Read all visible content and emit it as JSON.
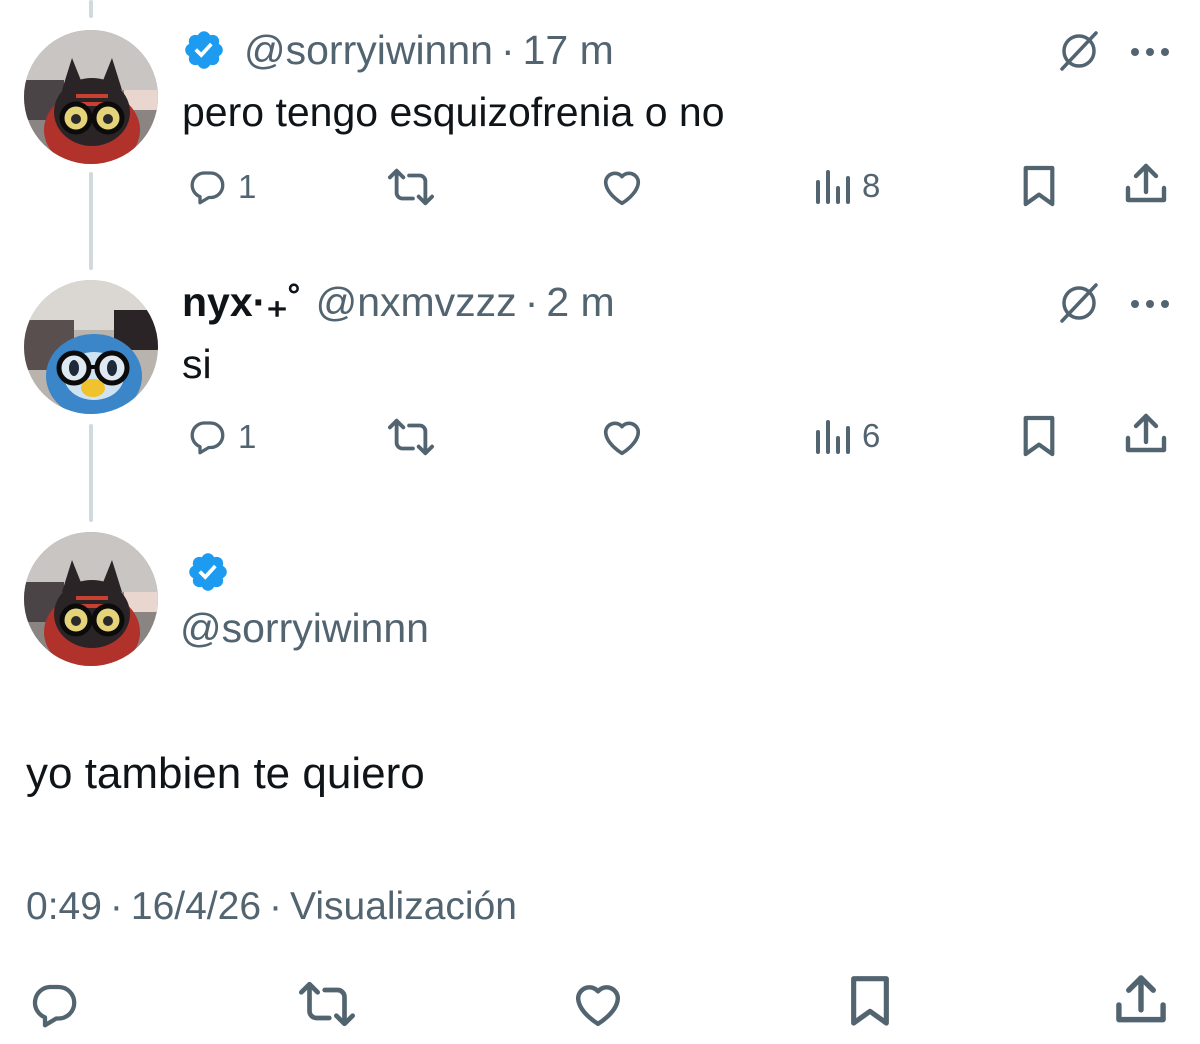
{
  "tweets": [
    {
      "handle": "@sorryiwinnn",
      "time": "17 m",
      "text": "pero tengo esquizofrenia o no",
      "replies": "1",
      "views": "8",
      "avatar_icon": "litten-plush-avatar"
    },
    {
      "name": "nyx·₊˚",
      "handle": "@nxmvzzz",
      "time": "2 m",
      "text": "si",
      "replies": "1",
      "views": "6",
      "avatar_icon": "piplup-plush-avatar"
    }
  ],
  "main_tweet": {
    "handle": "@sorryiwinnn",
    "text": "yo tambien te quiero",
    "time": "0:49",
    "date": "16/4/26",
    "views_label": "Visualización",
    "avatar_icon": "litten-plush-avatar"
  },
  "colors": {
    "text": "#0f1419",
    "muted": "#536471",
    "verified": "#1d9bf0",
    "thread_line": "#cfd9de"
  }
}
